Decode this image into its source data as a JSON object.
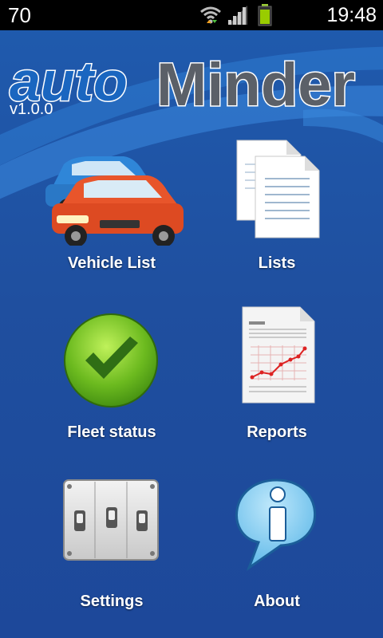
{
  "status_bar": {
    "left_number": "70",
    "time": "19:48"
  },
  "app": {
    "logo_part1": "auto",
    "logo_part2": "Minder",
    "version": "v1.0.0",
    "colors": {
      "background": "#1f5aad",
      "logo_blue": "#1a66c0",
      "logo_gray": "#5b6068"
    }
  },
  "menu": {
    "items": [
      {
        "label": "Vehicle List",
        "icon": "cars-icon"
      },
      {
        "label": "Lists",
        "icon": "documents-icon"
      },
      {
        "label": "Fleet status",
        "icon": "checkmark-icon"
      },
      {
        "label": "Reports",
        "icon": "report-icon"
      },
      {
        "label": "Settings",
        "icon": "switches-icon"
      },
      {
        "label": "About",
        "icon": "info-bubble-icon"
      }
    ]
  }
}
